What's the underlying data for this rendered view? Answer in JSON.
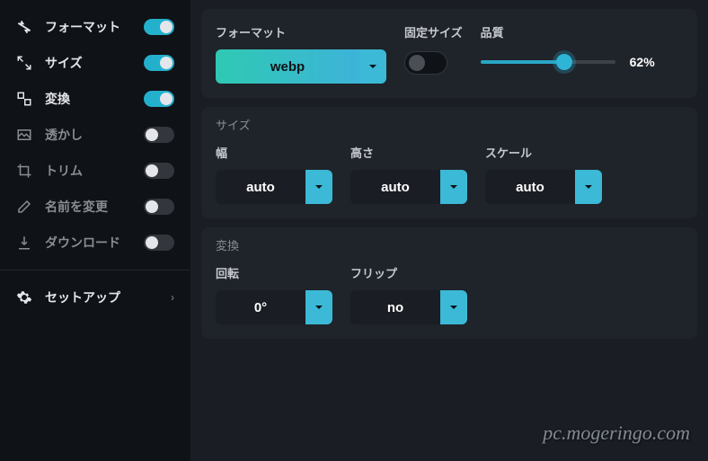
{
  "sidebar": {
    "items": [
      {
        "label": "フォーマット",
        "on": true
      },
      {
        "label": "サイズ",
        "on": true
      },
      {
        "label": "変換",
        "on": true
      },
      {
        "label": "透かし",
        "on": false
      },
      {
        "label": "トリム",
        "on": false
      },
      {
        "label": "名前を変更",
        "on": false
      },
      {
        "label": "ダウンロード",
        "on": false
      }
    ],
    "setup": "セットアップ"
  },
  "format": {
    "title": "フォーマット",
    "value": "webp",
    "fixed_label": "固定サイズ",
    "quality_label": "品質",
    "quality_value": "62%",
    "quality_pct": 62
  },
  "size": {
    "title": "サイズ",
    "width_label": "幅",
    "width_value": "auto",
    "height_label": "高さ",
    "height_value": "auto",
    "scale_label": "スケール",
    "scale_value": "auto"
  },
  "transform": {
    "title": "変換",
    "rotate_label": "回転",
    "rotate_value": "0°",
    "flip_label": "フリップ",
    "flip_value": "no"
  },
  "watermark": "pc.mogeringo.com"
}
